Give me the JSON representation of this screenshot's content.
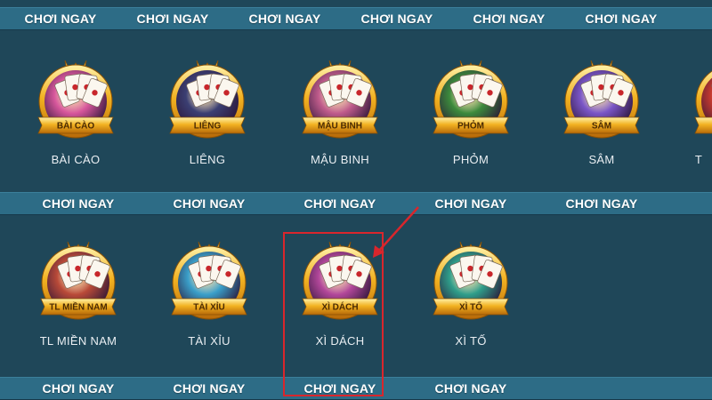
{
  "play_label": "CHƠI NGAY",
  "rows": [
    {
      "games": [
        {
          "name": "BÀI CÀO",
          "tag": "BÀI CÀO",
          "theme": "#d7579c"
        },
        {
          "name": "LIÊNG",
          "tag": "LIÊNG",
          "theme": "#3b3f73"
        },
        {
          "name": "MẬU BINH",
          "tag": "MẬU BINH",
          "theme": "#c05c8c"
        },
        {
          "name": "PHỎM",
          "tag": "PHỎM",
          "theme": "#3c8a3c"
        },
        {
          "name": "SÂM",
          "tag": "SÂM",
          "theme": "#7a56c7"
        },
        {
          "name": "T",
          "tag": "",
          "theme": "#c63a2f"
        }
      ]
    },
    {
      "games": [
        {
          "name": "TL MIỀN NAM",
          "tag": "TL MIỀN NAM",
          "theme": "#b94a38"
        },
        {
          "name": "TÀI XỈU",
          "tag": "TÀI XỈU",
          "theme": "#3a9fc9"
        },
        {
          "name": "XÌ DÁCH",
          "tag": "XÌ DÁCH",
          "theme": "#b2479a"
        },
        {
          "name": "XÌ TỐ",
          "tag": "XÌ TỐ",
          "theme": "#2f9e8a"
        }
      ]
    }
  ],
  "colors": {
    "background": "#1f4759",
    "bar": "#2d6c86",
    "frame_gold": "#e7a21b",
    "highlight": "#d9262c"
  }
}
